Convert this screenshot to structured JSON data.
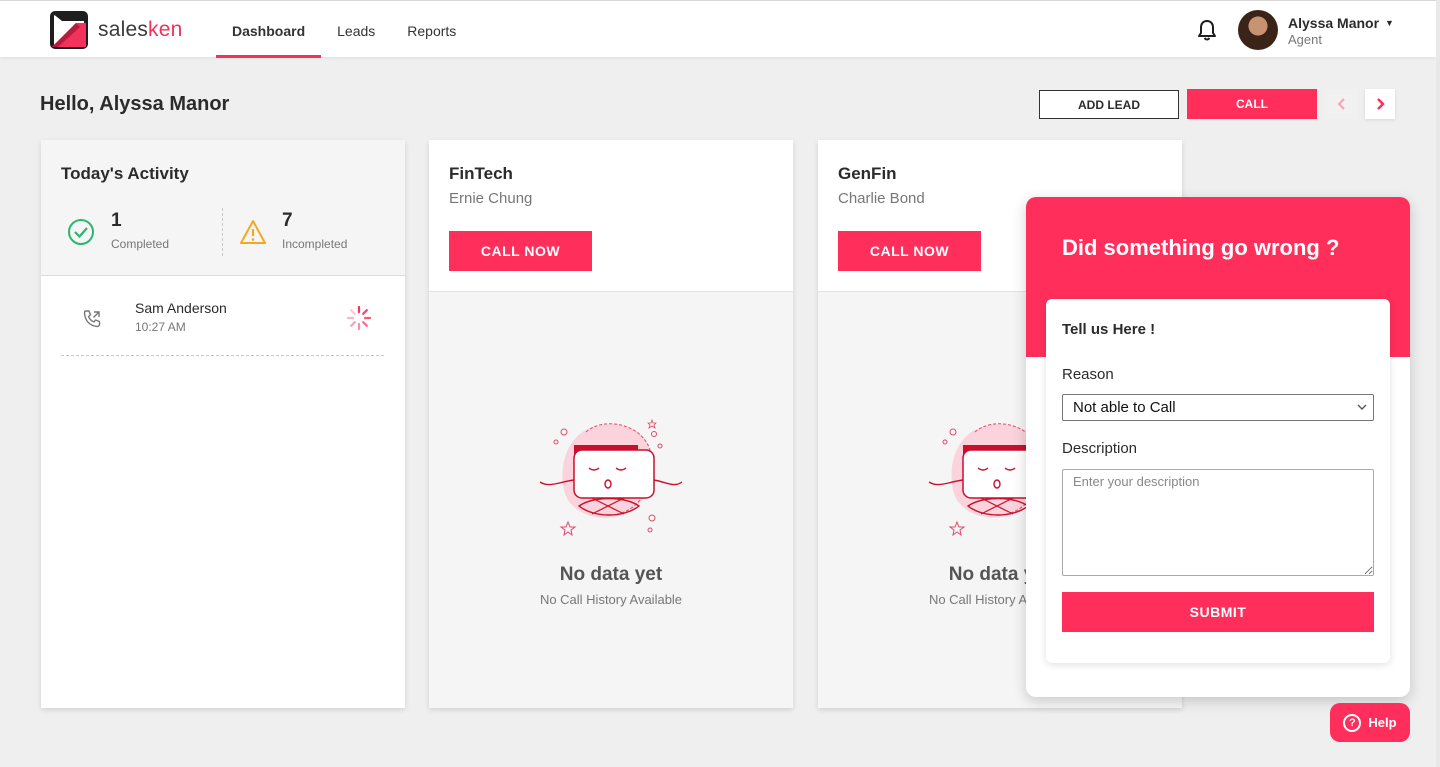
{
  "header": {
    "logo_text_a": "sales",
    "logo_text_b": "ken",
    "nav": [
      {
        "label": "Dashboard",
        "active": true
      },
      {
        "label": "Leads",
        "active": false
      },
      {
        "label": "Reports",
        "active": false
      }
    ],
    "user": {
      "name": "Alyssa Manor",
      "role": "Agent"
    }
  },
  "page": {
    "greeting": "Hello, Alyssa Manor",
    "add_lead_label": "ADD LEAD",
    "call_label": "CALL"
  },
  "activity": {
    "title": "Today's Activity",
    "completed_count": "1",
    "completed_label": "Completed",
    "incompleted_count": "7",
    "incompleted_label": "Incompleted",
    "items": [
      {
        "name": "Sam Anderson",
        "time": "10:27 AM"
      }
    ]
  },
  "leads": [
    {
      "company": "FinTech",
      "person": "Ernie Chung",
      "button": "CALL NOW",
      "empty_title": "No data yet",
      "empty_sub": "No Call History Available"
    },
    {
      "company": "GenFin",
      "person": "Charlie Bond",
      "button": "CALL NOW",
      "empty_title": "No data yet",
      "empty_sub": "No Call History Available"
    }
  ],
  "feedback": {
    "title": "Did something go wrong ?",
    "subtitle": "Tell us Here !",
    "reason_label": "Reason",
    "reason_value": "Not able to Call",
    "description_label": "Description",
    "description_placeholder": "Enter your description",
    "submit_label": "SUBMIT"
  },
  "help": {
    "label": "Help"
  },
  "colors": {
    "accent": "#ff2e5b",
    "success": "#2bb673",
    "warning": "#f5a623"
  }
}
